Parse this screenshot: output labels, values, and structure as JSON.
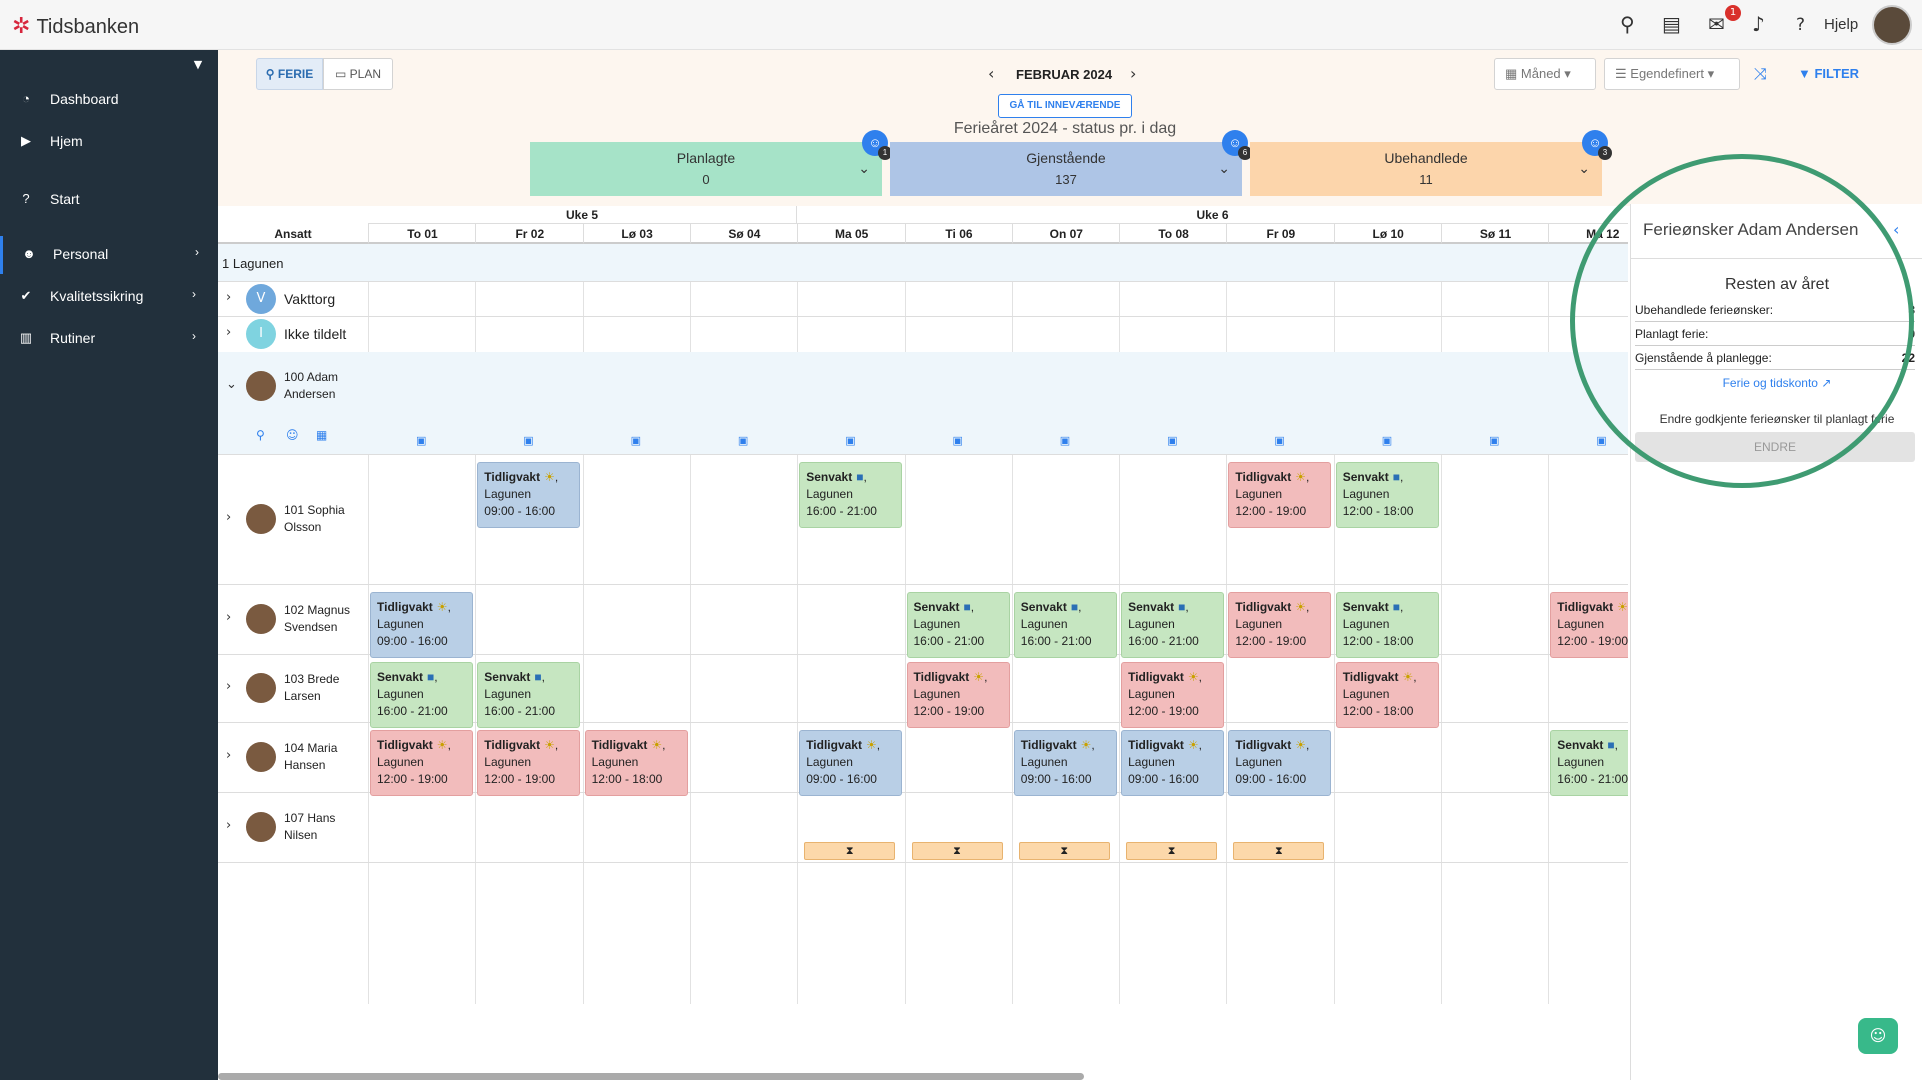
{
  "app": {
    "logo_text": "Tidsbanken",
    "help_label": "Hjelp",
    "mail_badge": "1"
  },
  "sidebar": {
    "items": [
      {
        "label": "Dashboard",
        "icon": "dashboard-icon"
      },
      {
        "label": "Hjem",
        "icon": "play-icon"
      },
      {
        "label": "Start",
        "icon": "question-icon"
      },
      {
        "label": "Personal",
        "icon": "users-icon"
      },
      {
        "label": "Kvalitetssikring",
        "icon": "check-icon"
      },
      {
        "label": "Rutiner",
        "icon": "chart-icon"
      }
    ]
  },
  "toolbar": {
    "ferie_label": "FERIE",
    "plan_label": "PLAN",
    "month_label": "FEBRUAR 2024",
    "today_label": "GÅ TIL INNEVÆRENDE",
    "year_status": "Ferieåret 2024 - status pr. i dag",
    "view_select": "Måned",
    "custom_select": "Egendefinert",
    "filter_label": "FILTER"
  },
  "stats": [
    {
      "label": "Planlagte",
      "value": "0",
      "badge": "1",
      "color": "#a6e3c8"
    },
    {
      "label": "Gjenstående",
      "value": "137",
      "badge": "6",
      "color": "#aec5e6"
    },
    {
      "label": "Ubehandlede",
      "value": "11",
      "badge": "3",
      "color": "#fcd5ab"
    }
  ],
  "grid": {
    "employee_header": "Ansatt",
    "weeks": [
      {
        "label": "Uke 5"
      },
      {
        "label": "Uke 6"
      }
    ],
    "days": [
      "To 01",
      "Fr 02",
      "Lø 03",
      "Sø 04",
      "Ma 05",
      "Ti 06",
      "On 07",
      "To 08",
      "Fr 09",
      "Lø 10",
      "Sø 11",
      "Ma 12"
    ],
    "group": "1 Lagunen",
    "rows": [
      {
        "name": "Vakttorg",
        "initial": "V",
        "color": "#6fa8dc"
      },
      {
        "name": "Ikke tildelt",
        "initial": "I",
        "color": "#7fd3e0"
      },
      {
        "name": "100 Adam Andersen"
      },
      {
        "name": "101 Sophia Olsson"
      },
      {
        "name": "102 Magnus Svendsen"
      },
      {
        "name": "103 Brede Larsen"
      },
      {
        "name": "104 Maria Hansen"
      },
      {
        "name": "107 Hans Nilsen"
      }
    ],
    "shifts": [
      {
        "row": 3,
        "day": 1,
        "type": "Tidligvakt",
        "icon": "☀",
        "place": "Lagunen",
        "time": "09:00 - 16:00",
        "style": "blue"
      },
      {
        "row": 3,
        "day": 4,
        "type": "Senvakt",
        "icon": "■",
        "place": "Lagunen",
        "time": "16:00 - 21:00",
        "style": "green"
      },
      {
        "row": 3,
        "day": 8,
        "type": "Tidligvakt",
        "icon": "☀",
        "place": "Lagunen",
        "time": "12:00 - 19:00",
        "style": "red"
      },
      {
        "row": 3,
        "day": 9,
        "type": "Senvakt",
        "icon": "■",
        "place": "Lagunen",
        "time": "12:00 - 18:00",
        "style": "green"
      },
      {
        "row": 4,
        "day": 0,
        "type": "Tidligvakt",
        "icon": "☀",
        "place": "Lagunen",
        "time": "09:00 - 16:00",
        "style": "blue"
      },
      {
        "row": 4,
        "day": 5,
        "type": "Senvakt",
        "icon": "■",
        "place": "Lagunen",
        "time": "16:00 - 21:00",
        "style": "green"
      },
      {
        "row": 4,
        "day": 6,
        "type": "Senvakt",
        "icon": "■",
        "place": "Lagunen",
        "time": "16:00 - 21:00",
        "style": "green"
      },
      {
        "row": 4,
        "day": 7,
        "type": "Senvakt",
        "icon": "■",
        "place": "Lagunen",
        "time": "16:00 - 21:00",
        "style": "green"
      },
      {
        "row": 4,
        "day": 8,
        "type": "Tidligvakt",
        "icon": "☀",
        "place": "Lagunen",
        "time": "12:00 - 19:00",
        "style": "red"
      },
      {
        "row": 4,
        "day": 9,
        "type": "Senvakt",
        "icon": "■",
        "place": "Lagunen",
        "time": "12:00 - 18:00",
        "style": "green"
      },
      {
        "row": 4,
        "day": 11,
        "type": "Tidligvakt",
        "icon": "☀",
        "place": "Lagunen",
        "time": "12:00 - 19:00",
        "style": "red"
      },
      {
        "row": 5,
        "day": 0,
        "type": "Senvakt",
        "icon": "■",
        "place": "Lagunen",
        "time": "16:00 - 21:00",
        "style": "green"
      },
      {
        "row": 5,
        "day": 1,
        "type": "Senvakt",
        "icon": "■",
        "place": "Lagunen",
        "time": "16:00 - 21:00",
        "style": "green"
      },
      {
        "row": 5,
        "day": 5,
        "type": "Tidligvakt",
        "icon": "☀",
        "place": "Lagunen",
        "time": "12:00 - 19:00",
        "style": "red"
      },
      {
        "row": 5,
        "day": 7,
        "type": "Tidligvakt",
        "icon": "☀",
        "place": "Lagunen",
        "time": "12:00 - 19:00",
        "style": "red"
      },
      {
        "row": 5,
        "day": 9,
        "type": "Tidligvakt",
        "icon": "☀",
        "place": "Lagunen",
        "time": "12:00 - 18:00",
        "style": "red"
      },
      {
        "row": 6,
        "day": 0,
        "type": "Tidligvakt",
        "icon": "☀",
        "place": "Lagunen",
        "time": "12:00 - 19:00",
        "style": "red"
      },
      {
        "row": 6,
        "day": 1,
        "type": "Tidligvakt",
        "icon": "☀",
        "place": "Lagunen",
        "time": "12:00 - 19:00",
        "style": "red"
      },
      {
        "row": 6,
        "day": 2,
        "type": "Tidligvakt",
        "icon": "☀",
        "place": "Lagunen",
        "time": "12:00 - 18:00",
        "style": "red"
      },
      {
        "row": 6,
        "day": 4,
        "type": "Tidligvakt",
        "icon": "☀",
        "place": "Lagunen",
        "time": "09:00 - 16:00",
        "style": "blue"
      },
      {
        "row": 6,
        "day": 6,
        "type": "Tidligvakt",
        "icon": "☀",
        "place": "Lagunen",
        "time": "09:00 - 16:00",
        "style": "blue"
      },
      {
        "row": 6,
        "day": 7,
        "type": "Tidligvakt",
        "icon": "☀",
        "place": "Lagunen",
        "time": "09:00 - 16:00",
        "style": "blue"
      },
      {
        "row": 6,
        "day": 8,
        "type": "Tidligvakt",
        "icon": "☀",
        "place": "Lagunen",
        "time": "09:00 - 16:00",
        "style": "blue"
      },
      {
        "row": 6,
        "day": 11,
        "type": "Senvakt",
        "icon": "■",
        "place": "Lagunen",
        "time": "16:00 - 21:00",
        "style": "green"
      }
    ],
    "pending_days": [
      4,
      5,
      6,
      7,
      8
    ]
  },
  "panel": {
    "title": "Ferieønsker Adam Andersen",
    "subtitle": "Resten av året",
    "rows": [
      {
        "label": "Ubehandlede ferieønsker:",
        "value": "3"
      },
      {
        "label": "Planlagt ferie:",
        "value": "0"
      },
      {
        "label": "Gjenstående å planlegge:",
        "value": "22"
      }
    ],
    "link": "Ferie og tidskonto",
    "note": "Endre godkjente ferieønsker til planlagt ferie",
    "button": "ENDRE"
  }
}
